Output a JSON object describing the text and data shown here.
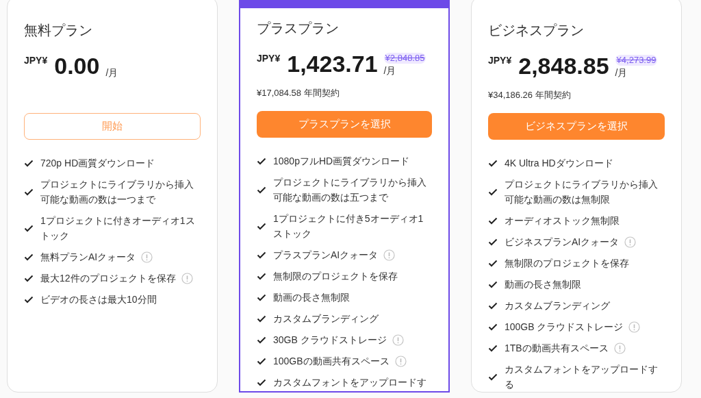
{
  "plans": [
    {
      "name": "無料プラン",
      "featured": false,
      "currency": "JPY¥",
      "price": "0.00",
      "per": "/月",
      "button": {
        "label": "開始",
        "kind": "outline"
      },
      "features": [
        {
          "text": "720p HD画質ダウンロード",
          "info": false
        },
        {
          "text": "プロジェクトにライブラリから挿入可能な動画の数は一つまで",
          "info": false
        },
        {
          "text": "1プロジェクトに付きオーディオ1ストック",
          "info": false
        },
        {
          "text": "無料プランAIクォータ",
          "info": true
        },
        {
          "text": "最大12件のプロジェクトを保存",
          "info": true
        },
        {
          "text": "ビデオの長さは最大10分間",
          "info": false
        }
      ]
    },
    {
      "name": "プラスプラン",
      "featured": true,
      "currency": "JPY¥",
      "price": "1,423.71",
      "original_price": "¥2,848.85",
      "per": "/月",
      "annual": "¥17,084.58 年間契約",
      "button": {
        "label": "プラスプランを選択",
        "kind": "filled"
      },
      "features": [
        {
          "text": "1080pフルHD画質ダウンロード",
          "info": false
        },
        {
          "text": "プロジェクトにライブラリから挿入可能な動画の数は五つまで",
          "info": false
        },
        {
          "text": "1プロジェクトに付き5オーディオ1ストック",
          "info": false
        },
        {
          "text": "プラスプランAIクォータ",
          "info": true
        },
        {
          "text": "無制限のプロジェクトを保存",
          "info": false
        },
        {
          "text": "動画の長さ無制限",
          "info": false
        },
        {
          "text": "カスタムブランディング",
          "info": false
        },
        {
          "text": "30GB クラウドストレージ",
          "info": true
        },
        {
          "text": "100GBの動画共有スペース",
          "info": true
        },
        {
          "text": "カスタムフォントをアップロードす",
          "info": false
        }
      ]
    },
    {
      "name": "ビジネスプラン",
      "featured": false,
      "currency": "JPY¥",
      "price": "2,848.85",
      "original_price": "¥4,273.99",
      "per": "/月",
      "annual": "¥34,186.26 年間契約",
      "button": {
        "label": "ビジネスプランを選択",
        "kind": "filled"
      },
      "features": [
        {
          "text": "4K Ultra HDダウンロード",
          "info": false
        },
        {
          "text": "プロジェクトにライブラリから挿入可能な動画の数は無制限",
          "info": false
        },
        {
          "text": "オーディオストック無制限",
          "info": false
        },
        {
          "text": "ビジネスプランAIクォータ",
          "info": true
        },
        {
          "text": "無制限のプロジェクトを保存",
          "info": false
        },
        {
          "text": "動画の長さ無制限",
          "info": false
        },
        {
          "text": "カスタムブランディング",
          "info": false
        },
        {
          "text": "100GB クラウドストレージ",
          "info": true
        },
        {
          "text": "1TBの動画共有スペース",
          "info": true
        },
        {
          "text": "カスタムフォントをアップロードする",
          "info": false
        }
      ]
    }
  ]
}
